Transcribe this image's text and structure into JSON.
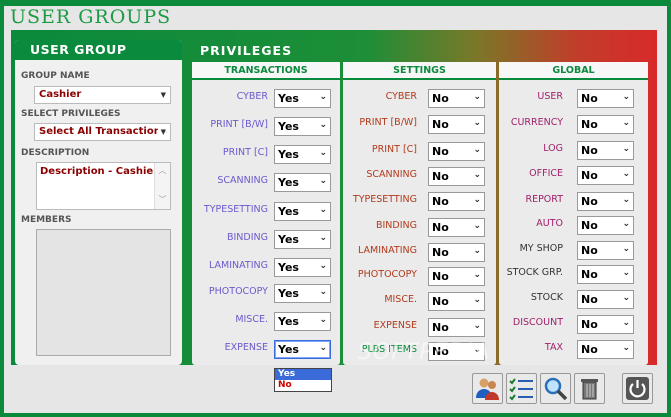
{
  "app": {
    "title": "USER GROUPS"
  },
  "user_group": {
    "header": "USER GROUP",
    "group_name_label": "GROUP NAME",
    "group_name_value": "Cashier",
    "select_privileges_label": "SELECT PRIVILEGES",
    "select_privileges_value": "Select All Transactions",
    "description_label": "DESCRIPTION",
    "description_value": "Description - Cashier",
    "members_label": "MEMBERS"
  },
  "privileges": {
    "header": "PRIVILEGES",
    "transactions": {
      "title": "TRANSACTIONS",
      "rows": [
        {
          "label": "CYBER",
          "value": "Yes"
        },
        {
          "label": "PRINT [B/W]",
          "value": "Yes"
        },
        {
          "label": "PRINT [C]",
          "value": "Yes"
        },
        {
          "label": "SCANNING",
          "value": "Yes"
        },
        {
          "label": "TYPESETTING",
          "value": "Yes"
        },
        {
          "label": "BINDING",
          "value": "Yes"
        },
        {
          "label": "LAMINATING",
          "value": "Yes"
        },
        {
          "label": "PHOTOCOPY",
          "value": "Yes"
        },
        {
          "label": "MISCE.",
          "value": "Yes"
        },
        {
          "label": "EXPENSE",
          "value": "Yes"
        }
      ]
    },
    "settings": {
      "title": "SETTINGS",
      "rows": [
        {
          "label": "CYBER",
          "value": "No"
        },
        {
          "label": "PRINT [B/W]",
          "value": "No"
        },
        {
          "label": "PRINT [C]",
          "value": "No"
        },
        {
          "label": "SCANNING",
          "value": "No"
        },
        {
          "label": "TYPESETTING",
          "value": "No"
        },
        {
          "label": "BINDING",
          "value": "No"
        },
        {
          "label": "LAMINATING",
          "value": "No"
        },
        {
          "label": "PHOTOCOPY",
          "value": "No"
        },
        {
          "label": "MISCE.",
          "value": "No"
        },
        {
          "label": "EXPENSE",
          "value": "No"
        },
        {
          "label": "PLBS ITEMS",
          "value": "No"
        }
      ]
    },
    "global": {
      "title": "GLOBAL",
      "rows": [
        {
          "label": "USER",
          "value": "No"
        },
        {
          "label": "CURRENCY",
          "value": "No"
        },
        {
          "label": "LOG",
          "value": "No"
        },
        {
          "label": "OFFICE",
          "value": "No"
        },
        {
          "label": "REPORT",
          "value": "No"
        },
        {
          "label": "AUTO",
          "value": "No"
        },
        {
          "label": "MY SHOP",
          "value": "No"
        },
        {
          "label": "STOCK GRP.",
          "value": "No"
        },
        {
          "label": "STOCK",
          "value": "No"
        },
        {
          "label": "DISCOUNT",
          "value": "No"
        },
        {
          "label": "TAX",
          "value": "No"
        }
      ]
    }
  },
  "dropdown": {
    "options": [
      "Yes",
      "No"
    ]
  },
  "watermark": "SOFTPEDIA",
  "colors": {
    "green": "#0a8a3c",
    "trans_label": "#6a5acd",
    "settings_label": "#b23a1c",
    "global_label": "#a0206a",
    "plbs_label": "#0a8a3c"
  },
  "toolbar": {
    "icons": [
      "users-icon",
      "checklist-icon",
      "search-icon",
      "trash-icon",
      "power-icon"
    ]
  }
}
